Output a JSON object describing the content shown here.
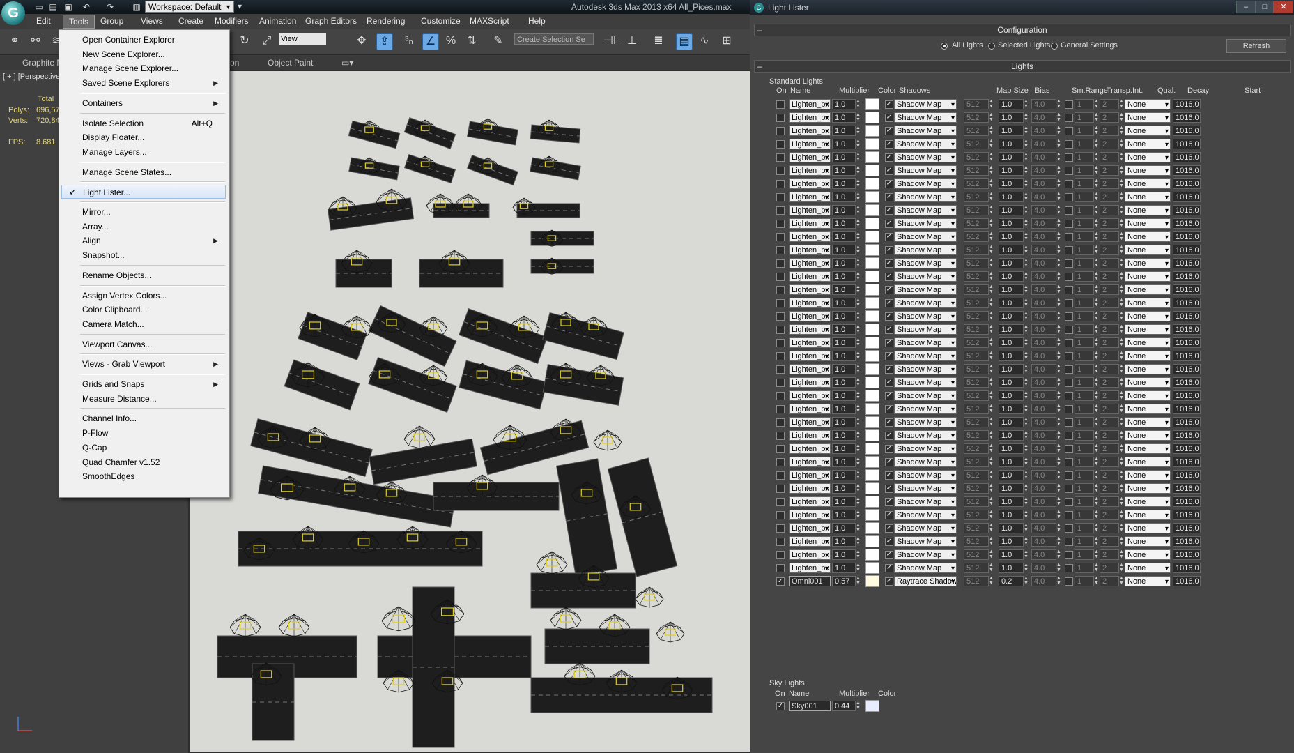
{
  "max": {
    "workspace": "Workspace: Default",
    "app_title": "Autodesk 3ds Max  2013 x64      All_Pices.max",
    "menus": [
      "Edit",
      "Tools",
      "Group",
      "Views",
      "Create",
      "Modifiers",
      "Animation",
      "Graph Editors",
      "Rendering",
      "Customize",
      "MAXScript",
      "Help"
    ],
    "view_select": "View",
    "selection_set_placeholder": "Create Selection Se",
    "ribbon_tabs": [
      "Graphite M",
      "on",
      "Object Paint"
    ],
    "viewport_label": "[ + ] [Perspective",
    "stats": {
      "total_label": "Total",
      "polys_label": "Polys:",
      "polys_value": "696,57",
      "verts_label": "Verts:",
      "verts_value": "720,84",
      "fps_label": "FPS:",
      "fps_value": "8.681"
    }
  },
  "tools_menu": [
    {
      "label": "Open Container Explorer"
    },
    {
      "label": "New Scene Explorer..."
    },
    {
      "label": "Manage Scene Explorer..."
    },
    {
      "label": "Saved Scene Explorers",
      "submenu": true
    },
    {
      "sep": true
    },
    {
      "label": "Containers",
      "submenu": true
    },
    {
      "sep": true
    },
    {
      "label": "Isolate Selection",
      "shortcut": "Alt+Q"
    },
    {
      "label": "Display Floater..."
    },
    {
      "label": "Manage Layers..."
    },
    {
      "sep": true
    },
    {
      "label": "Manage Scene States..."
    },
    {
      "sep": true
    },
    {
      "label": "Light Lister...",
      "checked": true
    },
    {
      "sep": true
    },
    {
      "label": "Mirror..."
    },
    {
      "label": "Array..."
    },
    {
      "label": "Align",
      "submenu": true
    },
    {
      "label": "Snapshot..."
    },
    {
      "sep": true
    },
    {
      "label": "Rename Objects..."
    },
    {
      "sep": true
    },
    {
      "label": "Assign Vertex Colors..."
    },
    {
      "label": "Color Clipboard..."
    },
    {
      "label": "Camera Match..."
    },
    {
      "sep": true
    },
    {
      "label": "Viewport Canvas..."
    },
    {
      "sep": true
    },
    {
      "label": "Views - Grab Viewport",
      "submenu": true
    },
    {
      "sep": true
    },
    {
      "label": "Grids and Snaps",
      "submenu": true
    },
    {
      "label": "Measure Distance..."
    },
    {
      "sep": true
    },
    {
      "label": "Channel Info..."
    },
    {
      "label": "P-Flow"
    },
    {
      "label": "Q-Cap"
    },
    {
      "label": "Quad Chamfer v1.52"
    },
    {
      "label": "SmoothEdges"
    }
  ],
  "light_lister": {
    "title": "Light Lister",
    "config_header": "Configuration",
    "radio_options": [
      "All Lights",
      "Selected Lights",
      "General Settings"
    ],
    "radio_selected": "All Lights",
    "refresh_label": "Refresh",
    "lights_header": "Lights",
    "standard_label": "Standard Lights",
    "columns": [
      "On",
      "Name",
      "Multiplier",
      "Color",
      "Shadows",
      "Map Size",
      "Bias",
      "Sm.Range",
      "Transp.",
      "Int.",
      "Qual.",
      "Decay",
      "Start"
    ],
    "standard_rows": {
      "count": 36,
      "on": false,
      "name": "Lighten_px",
      "multiplier": "1.0",
      "color": "#ffffff",
      "shadows_on": true,
      "shadow_type": "Shadow Map",
      "map_size": "512",
      "bias": "1.0",
      "sm_range": "4.0",
      "transp": false,
      "int": "1",
      "qual": "2",
      "decay": "None",
      "start": "1016.0"
    },
    "omni_row": {
      "on": true,
      "name": "Omni001",
      "multiplier": "0.57",
      "color": "#fffbe0",
      "shadows_on": true,
      "shadow_type": "Raytrace Shadow",
      "map_size": "512",
      "bias": "0.2",
      "sm_range": "4.0",
      "transp": false,
      "int": "1",
      "qual": "2",
      "decay": "None",
      "start": "1016.0"
    },
    "sky_label": "Sky Lights",
    "sky_columns": [
      "On",
      "Name",
      "Multiplier",
      "Color"
    ],
    "sky_row": {
      "on": true,
      "name": "Sky001",
      "multiplier": "0.44",
      "color": "#e8ecff"
    }
  }
}
